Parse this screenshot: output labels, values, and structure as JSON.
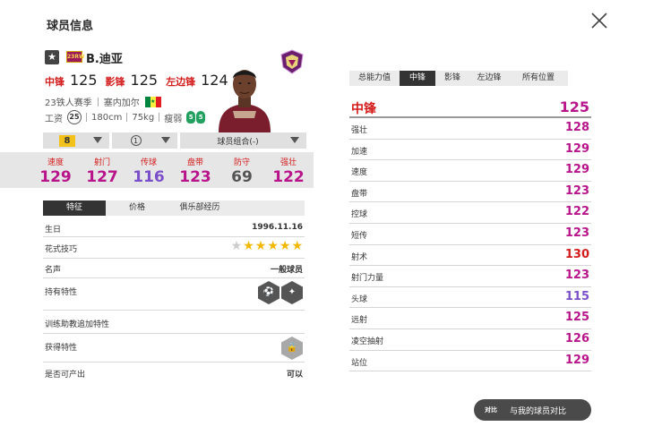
{
  "page": {
    "title": "球员信息"
  },
  "player": {
    "season_badge": "23RW",
    "name": "B.迪亚",
    "positions": [
      {
        "label": "中锋",
        "value": "125"
      },
      {
        "label": "影锋",
        "value": "125"
      },
      {
        "label": "左边锋",
        "value": "124"
      }
    ],
    "season": "23铁人赛季",
    "nationality": "塞内加尔",
    "flag_colors": [
      "#00853f",
      "#fdef42",
      "#e31b23"
    ],
    "wage_label": "工资",
    "age": "25",
    "height": "180cm",
    "weight": "75kg",
    "build": "瘦弱",
    "foot_left": "5",
    "foot_right": "5",
    "foot_color": "#22a060"
  },
  "dropdowns": {
    "level": "8",
    "rank": "1",
    "combo": "球员组合(-)"
  },
  "stats": [
    {
      "label": "速度",
      "value": "129",
      "color": "#b8158b"
    },
    {
      "label": "射门",
      "value": "127",
      "color": "#b8158b"
    },
    {
      "label": "传球",
      "value": "116",
      "color": "#7b4fc9"
    },
    {
      "label": "盘带",
      "value": "123",
      "color": "#b8158b"
    },
    {
      "label": "防守",
      "value": "69",
      "color": "#555555"
    },
    {
      "label": "强壮",
      "value": "122",
      "color": "#b8158b"
    }
  ],
  "info_tabs": [
    "特征",
    "价格",
    "俱乐部经历"
  ],
  "info": {
    "birthday_label": "生日",
    "birthday": "1996.11.16",
    "skill_label": "花式技巧",
    "skill_stars": 5,
    "skill_max": 6,
    "fame_label": "名声",
    "fame": "一般球员",
    "traits_label": "持有特性",
    "training_label": "训练助教追加特性",
    "obtained_label": "获得特性",
    "producible_label": "是否可产出",
    "producible": "可以"
  },
  "pos_tabs": [
    "总能力值",
    "中锋",
    "影锋",
    "左边锋",
    "所有位置"
  ],
  "attr_head": {
    "label": "中锋",
    "value": "125"
  },
  "attributes": [
    {
      "label": "强壮",
      "value": "128",
      "color": "#b8158b"
    },
    {
      "label": "加速",
      "value": "129",
      "color": "#b8158b"
    },
    {
      "label": "速度",
      "value": "129",
      "color": "#b8158b"
    },
    {
      "label": "盘带",
      "value": "123",
      "color": "#b8158b"
    },
    {
      "label": "控球",
      "value": "122",
      "color": "#b8158b"
    },
    {
      "label": "短传",
      "value": "123",
      "color": "#b8158b"
    },
    {
      "label": "射术",
      "value": "130",
      "color": "#d31c1c"
    },
    {
      "label": "射门力量",
      "value": "123",
      "color": "#b8158b"
    },
    {
      "label": "头球",
      "value": "115",
      "color": "#7b4fc9"
    },
    {
      "label": "远射",
      "value": "125",
      "color": "#b8158b"
    },
    {
      "label": "凌空抽射",
      "value": "126",
      "color": "#b8158b"
    },
    {
      "label": "站位",
      "value": "129",
      "color": "#b8158b"
    }
  ],
  "compare": {
    "icon_text": "对比",
    "label": "与我的球员对比"
  }
}
